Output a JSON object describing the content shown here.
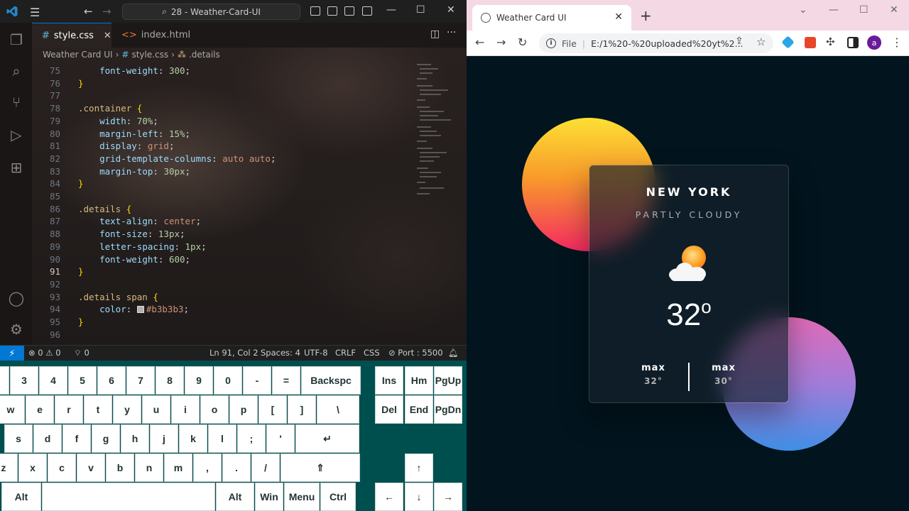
{
  "vscode": {
    "command_center": "28 - Weather-Card-UI",
    "tabs": [
      {
        "label": "style.css",
        "lang": "#",
        "active": true
      },
      {
        "label": "index.html",
        "lang": "<>",
        "active": false
      }
    ],
    "breadcrumb": [
      "Weather Card UI",
      "style.css",
      ".details"
    ],
    "code_lines": [
      {
        "n": "75",
        "html": "    <span class='prop'>font-weight</span>: <span class='num'>300</span>;"
      },
      {
        "n": "76",
        "html": "<span class='brace'>}</span>"
      },
      {
        "n": "77",
        "html": ""
      },
      {
        "n": "78",
        "html": "<span class='sel'>.container</span> <span class='brace'>{</span>"
      },
      {
        "n": "79",
        "html": "    <span class='prop'>width</span>: <span class='num'>70%</span>;"
      },
      {
        "n": "80",
        "html": "    <span class='prop'>margin-left</span>: <span class='num'>15%</span>;"
      },
      {
        "n": "81",
        "html": "    <span class='prop'>display</span>: <span class='val'>grid</span>;"
      },
      {
        "n": "82",
        "html": "    <span class='prop'>grid-template-columns</span>: <span class='val'>auto auto</span>;"
      },
      {
        "n": "83",
        "html": "    <span class='prop'>margin-top</span>: <span class='num'>30px</span>;"
      },
      {
        "n": "84",
        "html": "<span class='brace'>}</span>"
      },
      {
        "n": "85",
        "html": ""
      },
      {
        "n": "86",
        "html": "<span class='sel'>.details</span> <span class='brace'>{</span>"
      },
      {
        "n": "87",
        "html": "    <span class='prop'>text-align</span>: <span class='val'>center</span>;"
      },
      {
        "n": "88",
        "html": "    <span class='prop'>font-size</span>: <span class='num'>13px</span>;"
      },
      {
        "n": "89",
        "html": "    <span class='prop'>letter-spacing</span>: <span class='num'>1px</span>;"
      },
      {
        "n": "90",
        "html": "    <span class='prop'>font-weight</span>: <span class='num'>600</span>;"
      },
      {
        "n": "91",
        "html": "<span class='brace'>}</span>"
      },
      {
        "n": "92",
        "html": ""
      },
      {
        "n": "93",
        "html": "<span class='sel'>.details span</span> <span class='brace'>{</span>"
      },
      {
        "n": "94",
        "html": "    <span class='prop'>color</span>: <span class='swatch'></span><span class='val'>#b3b3b3</span>;"
      },
      {
        "n": "95",
        "html": "<span class='brace'>}</span>"
      },
      {
        "n": "96",
        "html": ""
      }
    ],
    "status": {
      "errors": "0",
      "warnings": "0",
      "ports": "0",
      "position": "Ln 91, Col 2",
      "spaces": "Spaces: 4",
      "encoding": "UTF-8",
      "eol": "CRLF",
      "language": "CSS",
      "port": "Port : 5500"
    }
  },
  "keyboard": {
    "rows": [
      [
        "3",
        "4",
        "5",
        "6",
        "7",
        "8",
        "9",
        "0",
        "-",
        "=",
        "Backspc"
      ],
      [
        "w",
        "e",
        "r",
        "t",
        "y",
        "u",
        "i",
        "o",
        "p",
        "[",
        "]",
        "\\"
      ],
      [
        "s",
        "d",
        "f",
        "g",
        "h",
        "j",
        "k",
        "l",
        ";",
        "'",
        "↵"
      ],
      [
        "z",
        "x",
        "c",
        "v",
        "b",
        "n",
        "m",
        ",",
        ".",
        "/",
        "⇑"
      ],
      [
        "Alt",
        "",
        "Alt",
        "Win",
        "Menu",
        "Ctrl"
      ]
    ],
    "nav": [
      "Ins",
      "Hm",
      "PgUp",
      "Del",
      "End",
      "PgDn"
    ],
    "arrows": [
      "↑",
      "←",
      "↓",
      "→"
    ]
  },
  "browser": {
    "tab_title": "Weather Card UI",
    "address": "E:/1%20-%20uploaded%20yt%2...",
    "address_prefix": "File",
    "avatar": "a",
    "card": {
      "city": "NEW YORK",
      "condition": "PARTLY CLOUDY",
      "temp": "32",
      "temp_unit": "o",
      "max_label": "max",
      "max_value": "32°",
      "min_label": "max",
      "min_value": "30°"
    }
  }
}
